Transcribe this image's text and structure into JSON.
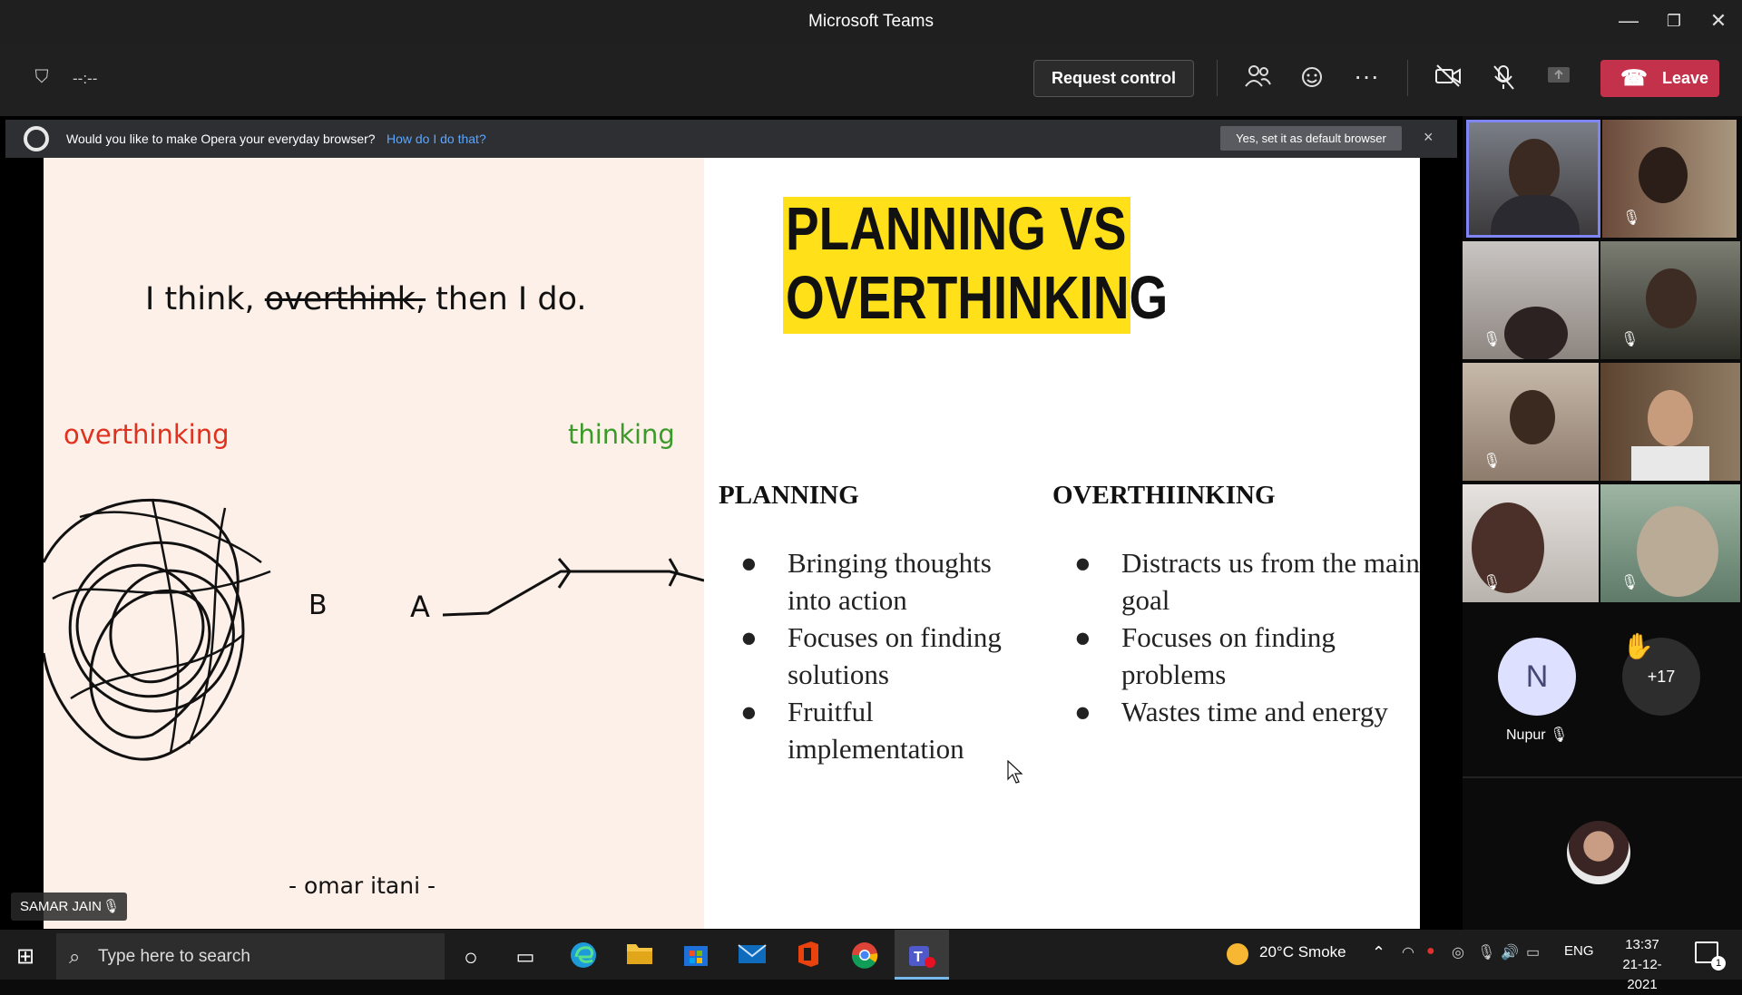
{
  "window": {
    "title": "Microsoft Teams"
  },
  "toolbar": {
    "timer": "--:--",
    "request_control_label": "Request control",
    "leave_label": "Leave"
  },
  "opera_bar": {
    "message": "Would you like to make Opera your everyday browser?",
    "link": "How do I do that?",
    "default_button": "Yes, set it as default browser",
    "close": "×"
  },
  "slide": {
    "quote": "I think, overthink, then I do.",
    "quote_pre": "I think, ",
    "quote_strike": "overthink,",
    "quote_post": " then I do.",
    "overthinking_label": "overthinking",
    "thinking_label": "thinking",
    "point_b": "B",
    "point_a": "A",
    "author": "- omar itani -",
    "title_line1": "PLANNING VS",
    "title_line2": "OVERTHINKING",
    "planning": {
      "heading": "PLANNING",
      "items": [
        "Bringing thoughts into action",
        "Focuses on finding solutions",
        "Fruitful implementation"
      ]
    },
    "overthinking": {
      "heading": "OVERTHIINKING",
      "items": [
        "Distracts us from the main goal",
        "Focuses on finding problems",
        "Wastes time and energy"
      ]
    }
  },
  "presenter": {
    "name": "SAMAR JAIN"
  },
  "gallery": {
    "nupur_initial": "N",
    "nupur_name": "Nupur",
    "more_count": "+17"
  },
  "taskbar": {
    "search_placeholder": "Type here to search",
    "weather": "20°C  Smoke",
    "language": "ENG",
    "time": "13:37",
    "date": "21-12-2021",
    "notification_count": "1"
  },
  "colors": {
    "leave": "#c4314b",
    "title_highlight": "#ffe019",
    "overthinking_red": "#e0301e",
    "thinking_green": "#3c9a2a",
    "active_tile_border": "#7f85f5"
  }
}
